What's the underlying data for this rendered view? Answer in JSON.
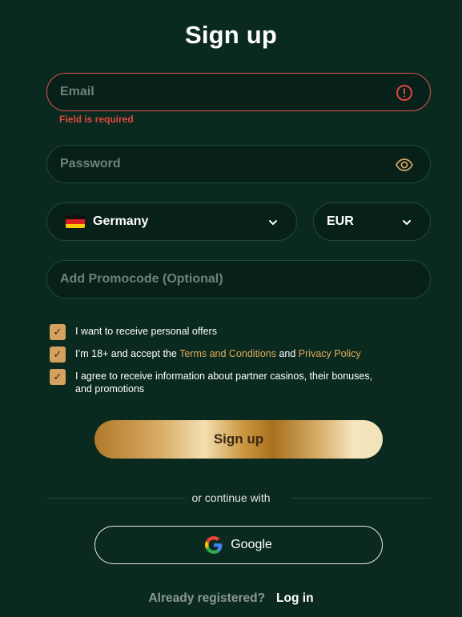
{
  "title": "Sign up",
  "email": {
    "placeholder": "Email",
    "error": "Field is required"
  },
  "password": {
    "placeholder": "Password"
  },
  "country": {
    "value": "Germany"
  },
  "currency": {
    "value": "EUR"
  },
  "promocode": {
    "placeholder": "Add Promocode (Optional)"
  },
  "consents": {
    "offers": "I want to receive personal offers",
    "terms_prefix": "I’m 18+ and accept the ",
    "terms_link": "Terms and Conditions",
    "terms_and": " and ",
    "privacy_link": "Privacy Policy",
    "partners": "I agree to receive information about partner casinos, their bonuses, and promotions",
    "check_glyph": "✓"
  },
  "signup_button": "Sign up",
  "divider": "or continue with",
  "google_button": "Google",
  "footer": {
    "question": "Already registered?",
    "login": "Log in"
  },
  "colors": {
    "background": "#0b2a1f",
    "accent": "#d4a15e",
    "error": "#e0473f",
    "link": "#e0aa5c"
  }
}
